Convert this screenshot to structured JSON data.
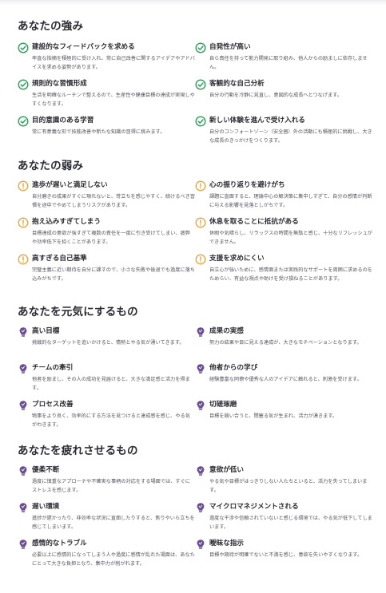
{
  "colors": {
    "strength": "#2e9e5b",
    "weakness": "#e6a23c",
    "bulb": "#6a4c93",
    "text": "#2b2b33",
    "desc": "#55555f"
  },
  "sections": [
    {
      "title": "あなたの強み",
      "icon": "check-circle-icon",
      "items": [
        {
          "title": "建設的なフィードバックを求める",
          "desc": "率直な指摘を積極的に受け入れ、常に自己改善に関するアイデアやアドバイスを求める姿勢があります。"
        },
        {
          "title": "自発性が高い",
          "desc": "自ら責任を持って能力開発に取り組み、他人からの励ましに依存しません。"
        },
        {
          "title": "規則的な習慣形成",
          "desc": "生活を明確なルーチンで整えるので、生産性や健康目標の達成が実現しやすくなります。"
        },
        {
          "title": "客観的な自己分析",
          "desc": "自分の行動を冷静に見直し、意図的な成長へとつなげます。"
        },
        {
          "title": "目的意識のある学習",
          "desc": "常に有意義な形で技能改善や新たな知識の習得に挑みます。"
        },
        {
          "title": "新しい体験を進んで受け入れる",
          "desc": "自分のコンフォートゾーン（安全圏）外の活動にも積極的に挑戦し、大きな成長のきっかけをつくります。"
        }
      ]
    },
    {
      "title": "あなたの弱み",
      "icon": "alert-circle-icon",
      "items": [
        {
          "title": "進歩が遅いと満足しない",
          "desc": "自分磨きの成果がすぐに現れないと、苛立ちを感じやすく、続けるべき習慣を途中でやめてしまうリスクがあります。"
        },
        {
          "title": "心の振り返りを避けがち",
          "desc": "課題に直面すると、理論中心の解決策に集中しすぎて、自分の感情が判断に与える影響を見落としがちです。"
        },
        {
          "title": "抱え込みすぎてしまう",
          "desc": "目標達成の意欲が強すぎて複数の責任を一度に引き受けてしまい、疲弊や効率低下を招くことがあります。"
        },
        {
          "title": "休息を取ることに抵抗がある",
          "desc": "休暇や気晴らし、リラックスの時間を無駄と感じ、十分なリフレッシュができません。"
        },
        {
          "title": "高すぎる自己基準",
          "desc": "完璧主義に近い期待を自分に課すので、小さな失敗や後退でも過度に落ち込みがちです。"
        },
        {
          "title": "支援を求めにくい",
          "desc": "自立心が強いために、感情面または実践的なサポートを周囲に求めるのをためらい、有益な視点や助けを受け損ねることがあります。"
        }
      ]
    },
    {
      "title": "あなたを元気にするもの",
      "icon": "lightbulb-icon",
      "items": [
        {
          "title": "高い目標",
          "desc": "挑戦的なターゲットを追いかけると、情熱とやる気が湧いてきます。"
        },
        {
          "title": "成果の実感",
          "desc": "努力の結果や目に見える達成が、大きなモチベーションとなります。"
        },
        {
          "title": "チームの牽引",
          "desc": "他者を励まし、その人の成功を見届けると、大きな満足感と活力を得ます。"
        },
        {
          "title": "他者からの学び",
          "desc": "経験豊富な同僚や優秀な人のアイデアに触れると、刺激を受けます。"
        },
        {
          "title": "プロセス改善",
          "desc": "物事をより良く、効率的にする方法を見つけると達成感を感じ、やる気がわきます。"
        },
        {
          "title": "切磋琢磨",
          "desc": "目標を競い合うと、閉塞る気が生まれ、活力が湧きます。"
        }
      ]
    },
    {
      "title": "あなたを疲れさせるもの",
      "icon": "lightbulb-icon",
      "items": [
        {
          "title": "優柔不断",
          "desc": "過度に慎重なアプローチや不確実な事柄の対応をする場面では、すぐにストレスを感じます。"
        },
        {
          "title": "意欲が低い",
          "desc": "やる気や目標がはっきりしない人たちといると、活力を失ってしまいます。"
        },
        {
          "title": "遅い環境",
          "desc": "進捗が遅かったり、非効率な状況に直面したりすると、焦りやいら立ちを感じてしまいます。"
        },
        {
          "title": "マイクロマネジメントされる",
          "desc": "過度な干渉や信頼されていないと感じる環境では、やる気が低下してしまいます。"
        },
        {
          "title": "感情的なトラブル",
          "desc": "必要以上に感情的になってしまう人や過度に感情が乱れた場面は、あなたにとって大きな負担となり、集中力が削がれます。"
        },
        {
          "title": "曖昧な指示",
          "desc": "目標や期待が明確でないと不満を感じ、意欲を失いやすくなります。"
        }
      ]
    }
  ]
}
